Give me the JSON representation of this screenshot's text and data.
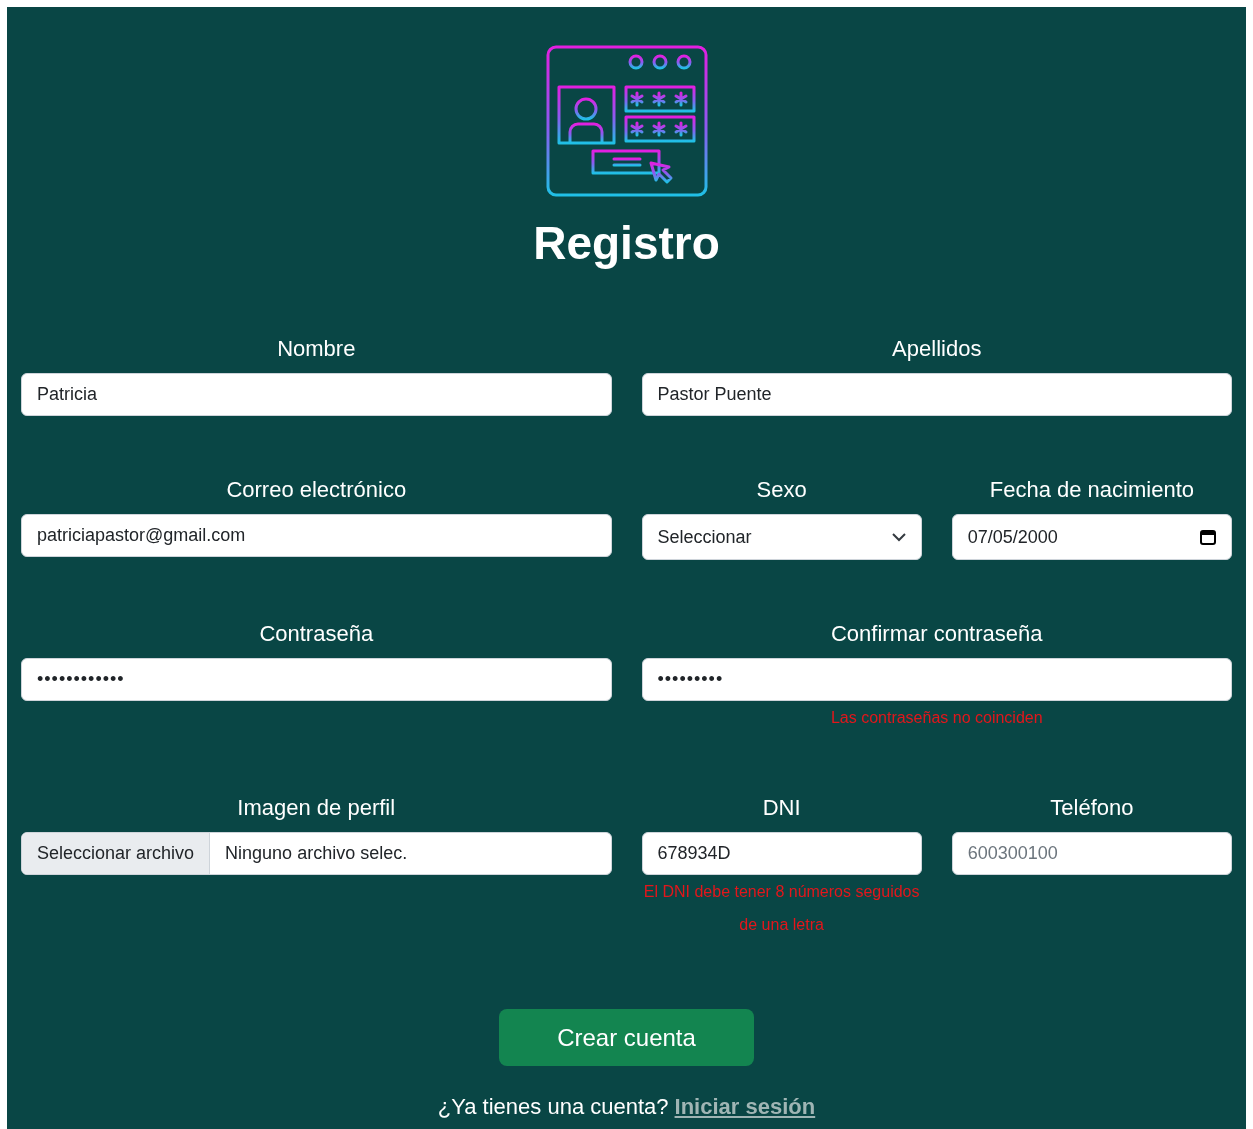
{
  "title": "Registro",
  "rows": [
    {
      "fields": [
        {
          "kind": "text",
          "label": "Nombre",
          "value": "Patricia"
        },
        {
          "kind": "text",
          "label": "Apellidos",
          "value": "Pastor Puente"
        }
      ]
    },
    {
      "fields": [
        {
          "kind": "text",
          "label": "Correo electrónico",
          "value": "patriciapastor@gmail.com"
        },
        {
          "kind": "select",
          "label": "Sexo",
          "value": "Seleccionar"
        },
        {
          "kind": "date",
          "label": "Fecha de nacimiento",
          "value": "07/05/2000"
        }
      ]
    },
    {
      "fields": [
        {
          "kind": "password",
          "label": "Contraseña",
          "value": "••••••••••••"
        },
        {
          "kind": "password",
          "label": "Confirmar contraseña",
          "value": "•••••••••",
          "error": "Las contraseñas no coinciden"
        }
      ]
    },
    {
      "fields": [
        {
          "kind": "file",
          "label": "Imagen de perfil",
          "button": "Seleccionar archivo",
          "value": "Ninguno archivo selec."
        },
        {
          "kind": "text",
          "label": "DNI",
          "value": "678934D",
          "error": "El DNI debe tener 8 números seguidos de una letra"
        },
        {
          "kind": "text",
          "label": "Teléfono",
          "placeholder": "600300100"
        }
      ]
    }
  ],
  "submit": "Crear cuenta",
  "footer": {
    "text": "¿Ya tienes una cuenta?",
    "link": "Iniciar sesión"
  }
}
